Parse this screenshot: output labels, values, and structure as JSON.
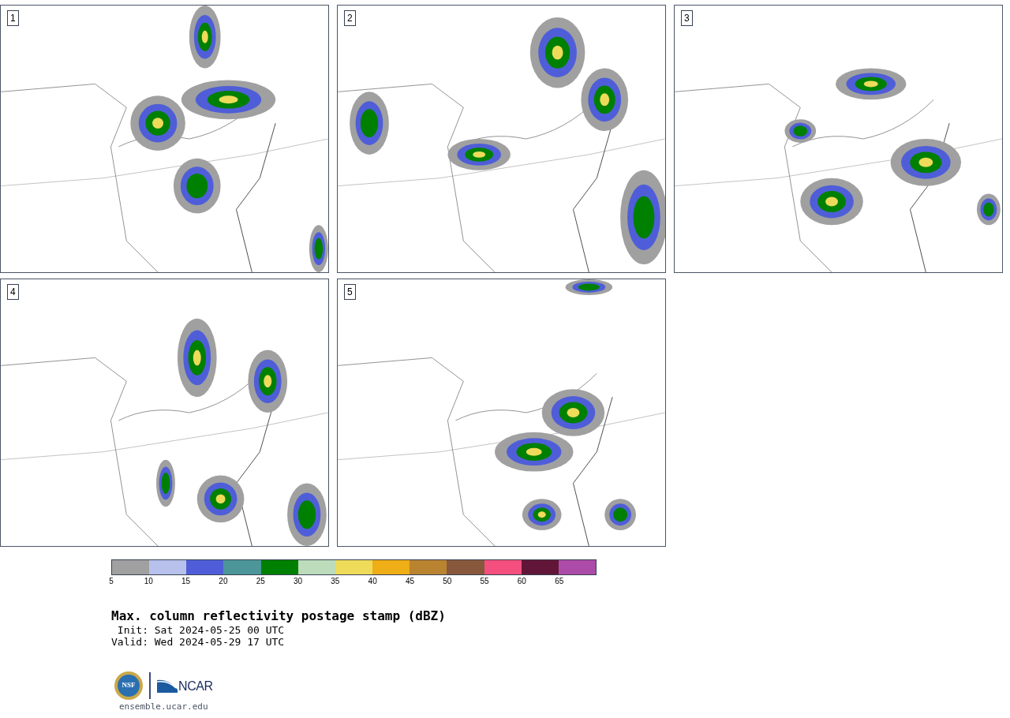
{
  "panels": [
    {
      "label": "1"
    },
    {
      "label": "2"
    },
    {
      "label": "3"
    },
    {
      "label": "4"
    },
    {
      "label": "5"
    }
  ],
  "colorbar": {
    "bins": [
      {
        "color": "#a0a0a0"
      },
      {
        "color": "#b7c1ec"
      },
      {
        "color": "#4f5ed8"
      },
      {
        "color": "#4c969a"
      },
      {
        "color": "#008000"
      },
      {
        "color": "#bcdcbb"
      },
      {
        "color": "#eedb5a"
      },
      {
        "color": "#efad16"
      },
      {
        "color": "#ba8330"
      },
      {
        "color": "#87583c"
      },
      {
        "color": "#f44f7e"
      },
      {
        "color": "#611638"
      },
      {
        "color": "#ad4ba8"
      }
    ],
    "ticks": [
      "5",
      "10",
      "15",
      "20",
      "25",
      "30",
      "35",
      "40",
      "45",
      "50",
      "55",
      "60",
      "65"
    ]
  },
  "title": "Max. column reflectivity postage stamp (dBZ)",
  "init": " Init: Sat 2024-05-25 00 UTC",
  "valid": "Valid: Wed 2024-05-29 17 UTC",
  "logos": {
    "nsf": "NSF",
    "ncar": "NCAR"
  },
  "url": "ensemble.ucar.edu"
}
